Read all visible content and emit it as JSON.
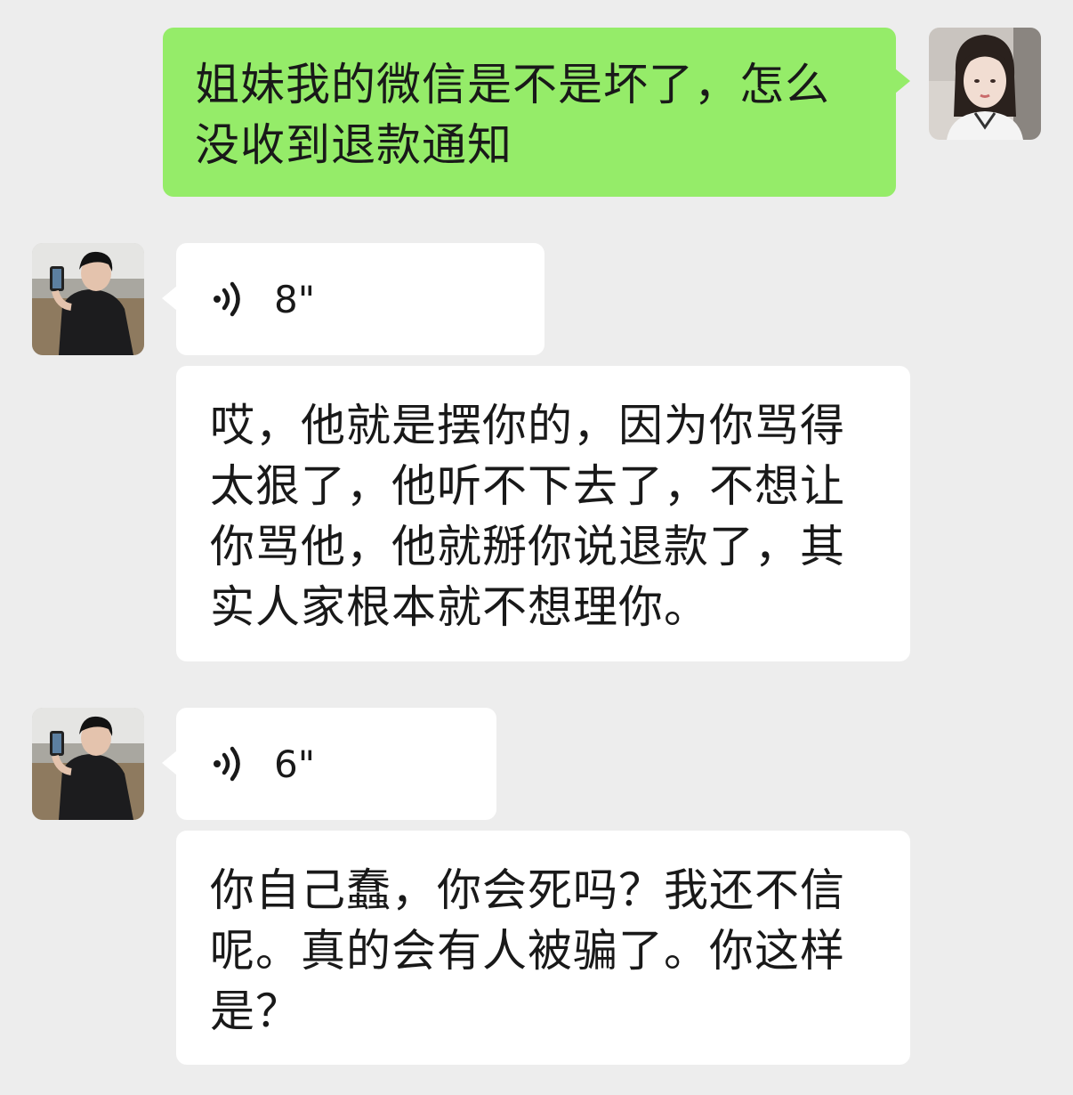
{
  "messages": [
    {
      "id": "m1",
      "sender": "me",
      "type": "text",
      "text": "姐妹我的微信是不是坏了，怎么没收到退款通知"
    },
    {
      "id": "m2",
      "sender": "other",
      "type": "voice",
      "duration": "8\""
    },
    {
      "id": "m3",
      "sender": "other",
      "type": "text",
      "text": "哎，他就是摆你的，因为你骂得太狠了，他听不下去了，不想让你骂他，他就掰你说退款了，其实人家根本就不想理你。"
    },
    {
      "id": "m4",
      "sender": "other",
      "type": "voice",
      "duration": "6\""
    },
    {
      "id": "m5",
      "sender": "other",
      "type": "text",
      "text": "你自己蠢，你会死吗？我还不信呢。真的会有人被骗了。你这样是？"
    }
  ],
  "colors": {
    "background": "#ededed",
    "my_bubble": "#95ec69",
    "their_bubble": "#ffffff",
    "text": "#191919"
  },
  "icons": {
    "voice": "voice-wave-icon"
  }
}
